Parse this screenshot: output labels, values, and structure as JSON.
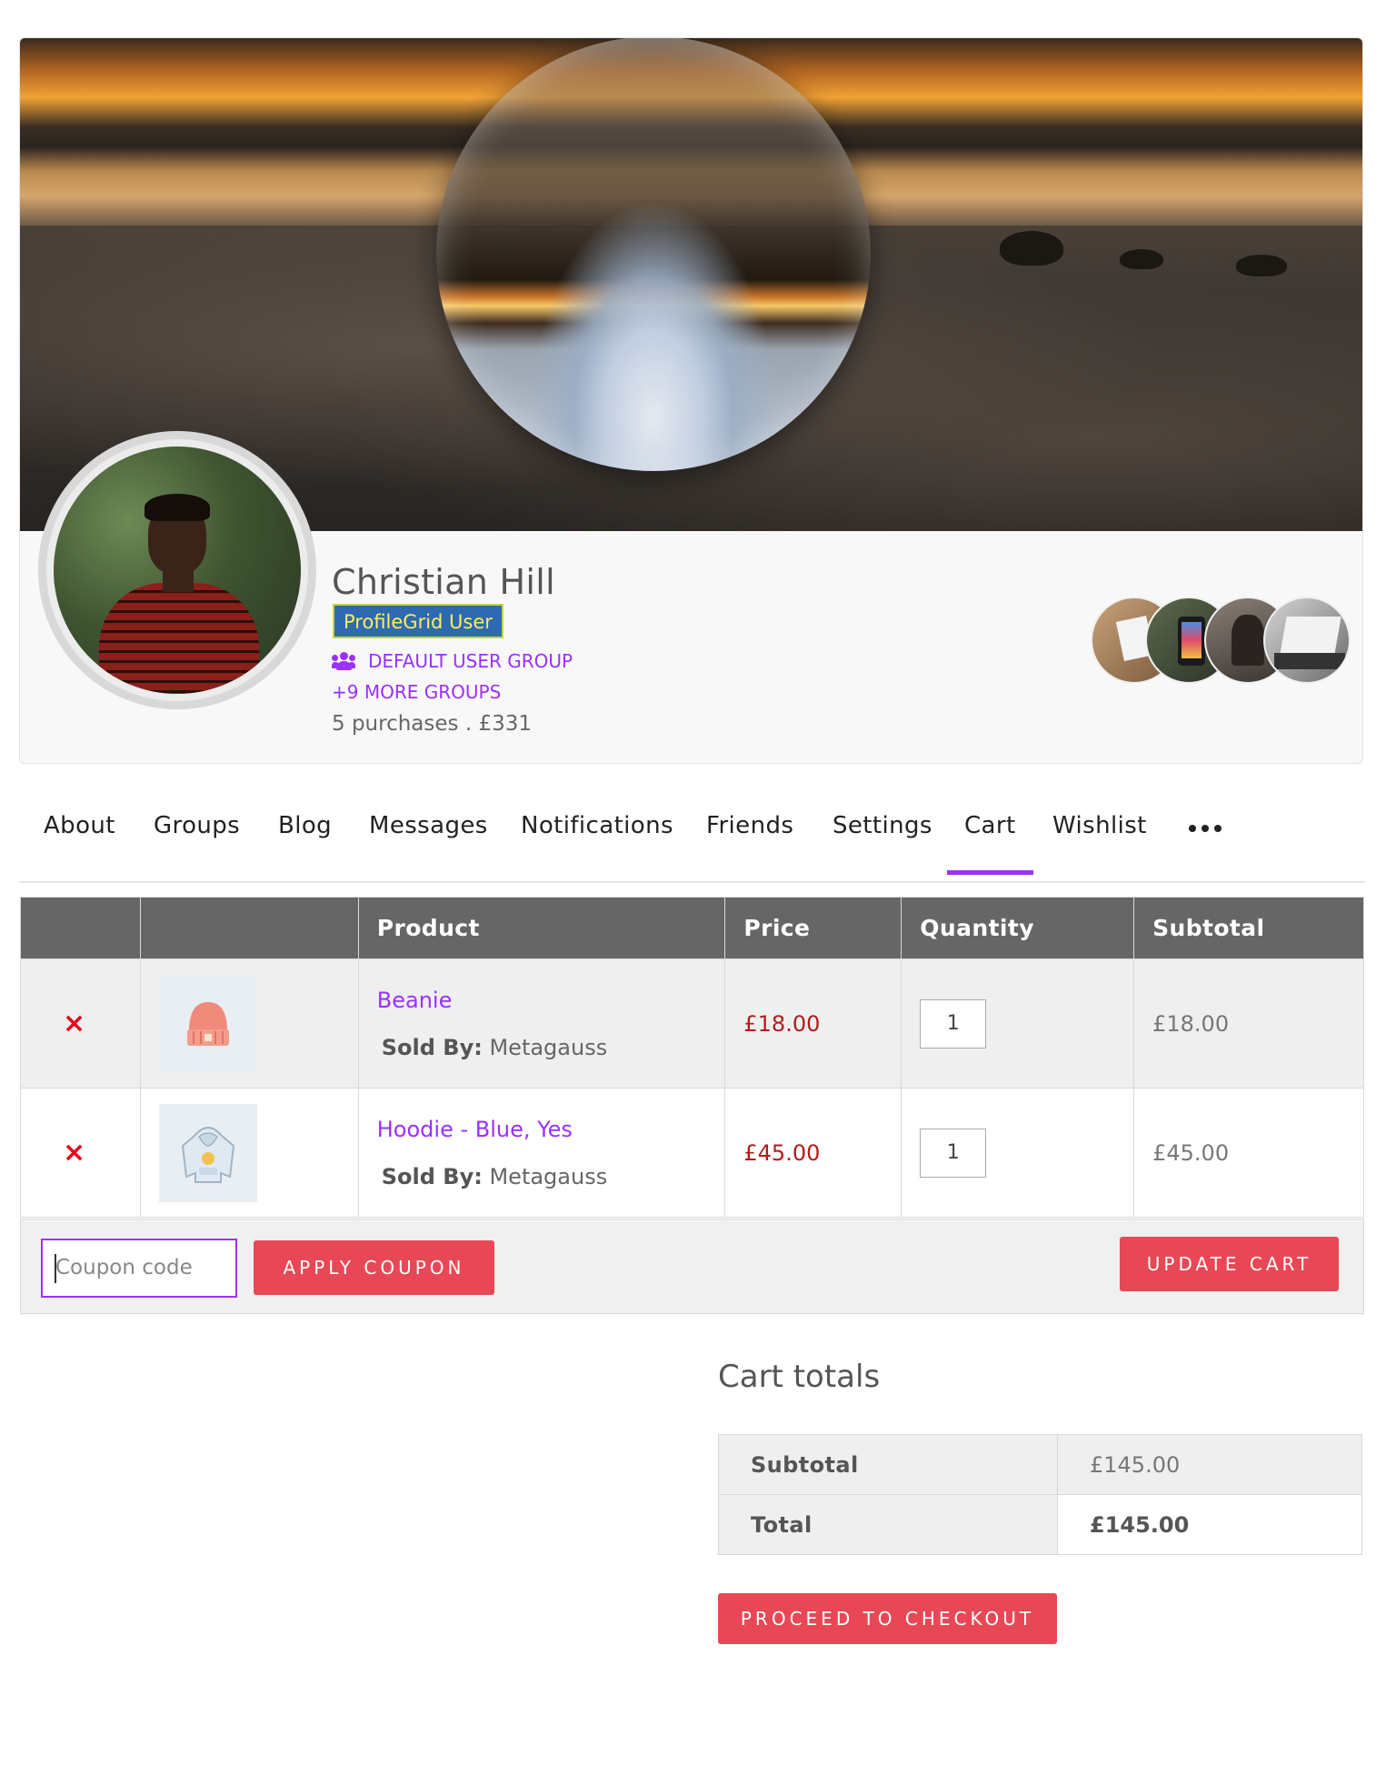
{
  "profile": {
    "name": "Christian Hill",
    "role_badge": "ProfileGrid User",
    "default_group": "DEFAULT USER GROUP",
    "more_groups": "+9 MORE GROUPS",
    "purchases": "5 purchases . £331"
  },
  "tabs": [
    {
      "label": "About"
    },
    {
      "label": "Groups"
    },
    {
      "label": "Blog"
    },
    {
      "label": "Messages"
    },
    {
      "label": "Notifications"
    },
    {
      "label": "Friends"
    },
    {
      "label": "Settings"
    },
    {
      "label": "Cart",
      "active": true
    },
    {
      "label": "Wishlist"
    }
  ],
  "cart": {
    "headers": {
      "product": "Product",
      "price": "Price",
      "quantity": "Quantity",
      "subtotal": "Subtotal"
    },
    "items": [
      {
        "remove": "×",
        "name": "Beanie",
        "sold_by_label": "Sold By:",
        "seller": "Metagauss",
        "price": "£18.00",
        "quantity": "1",
        "subtotal": "£18.00",
        "thumb_icon": "beanie-icon"
      },
      {
        "remove": "×",
        "name": "Hoodie - Blue, Yes",
        "sold_by_label": "Sold By:",
        "seller": "Metagauss",
        "price": "£45.00",
        "quantity": "1",
        "subtotal": "£45.00",
        "thumb_icon": "hoodie-icon"
      }
    ],
    "coupon_placeholder": "Coupon code",
    "apply_coupon_label": "APPLY COUPON",
    "update_cart_label": "UPDATE CART"
  },
  "totals": {
    "title": "Cart totals",
    "subtotal_label": "Subtotal",
    "subtotal_value": "£145.00",
    "total_label": "Total",
    "total_value": "£145.00",
    "checkout_label": "PROCEED TO CHECKOUT"
  },
  "colors": {
    "accent": "#9b30ff",
    "button": "#e84855",
    "price": "#b01c1c",
    "remove": "#e5091c",
    "header_bg": "#666666",
    "badge_bg": "#2e6ab0",
    "badge_text": "#ffee58"
  }
}
